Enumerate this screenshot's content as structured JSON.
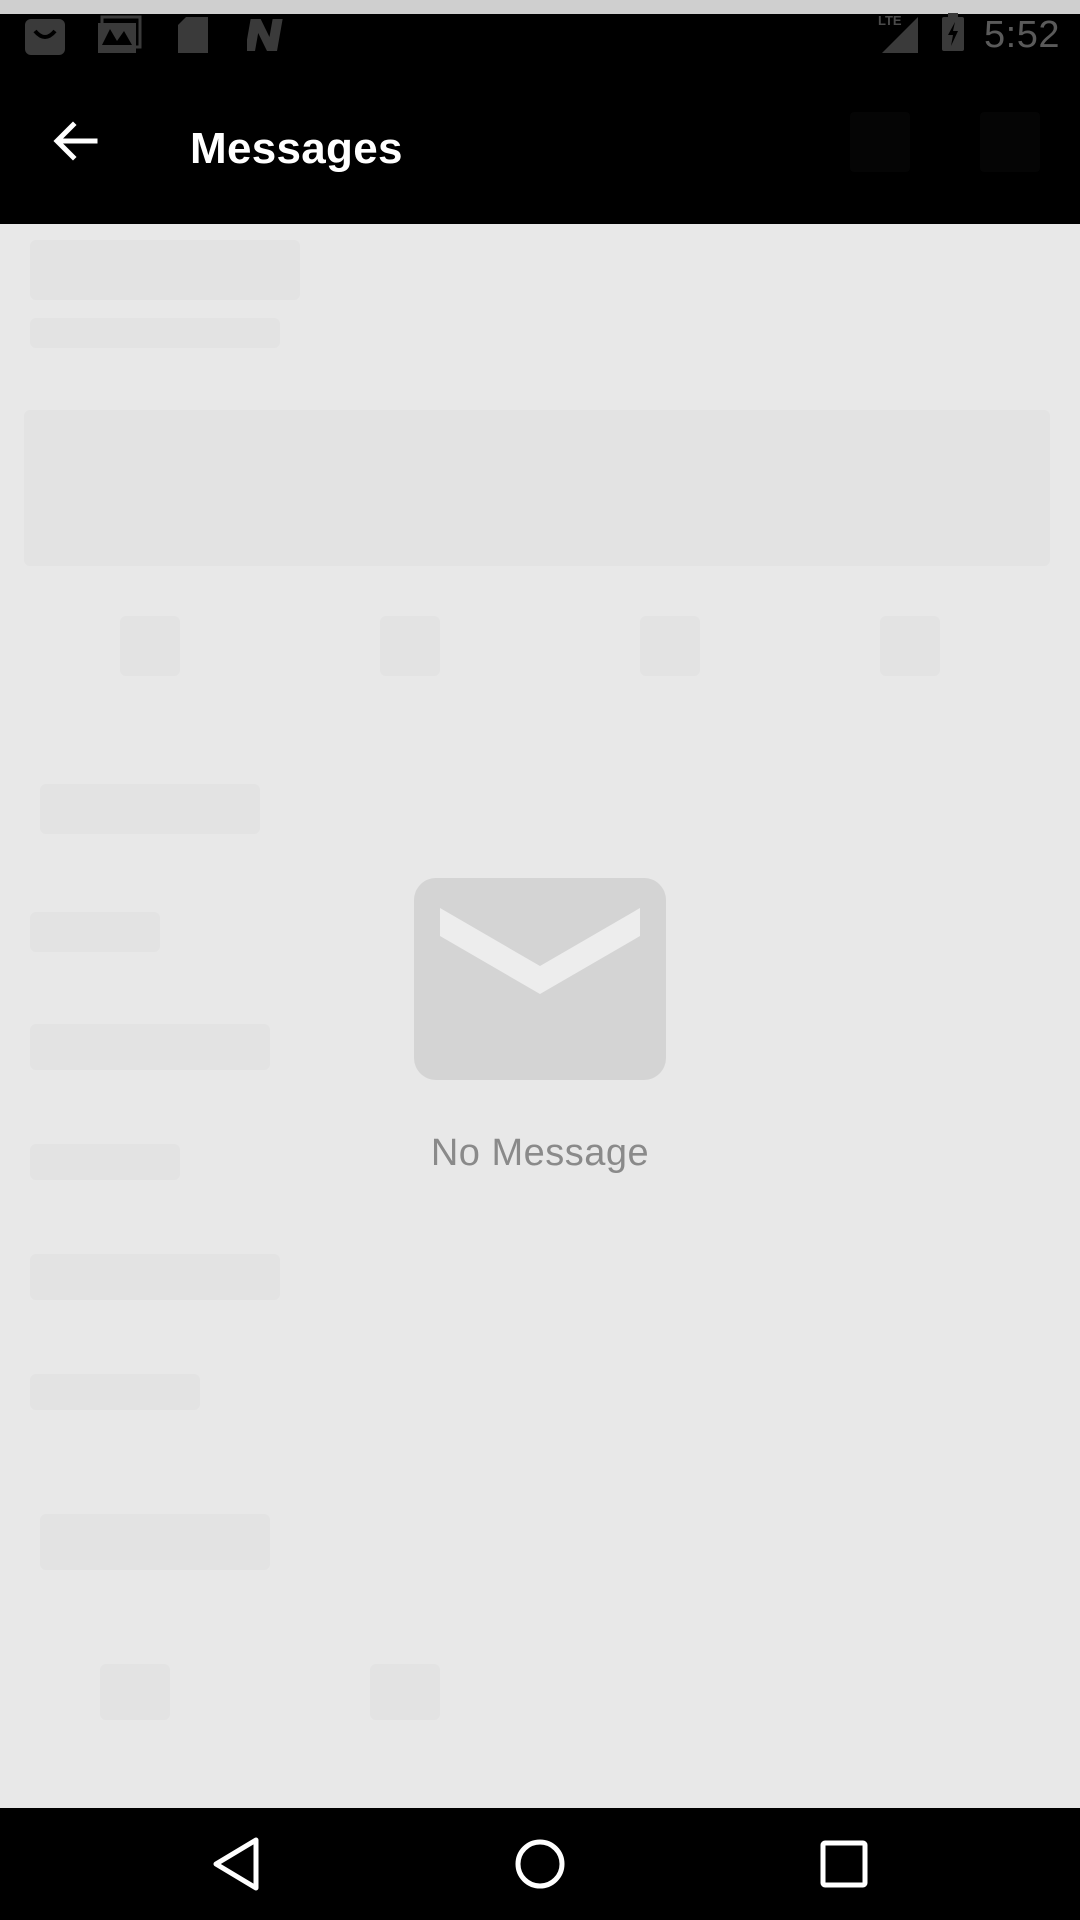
{
  "status_bar": {
    "time": "5:52",
    "icons": [
      "shopping-bag-icon",
      "gallery-icon",
      "sd-card-icon",
      "n-icon",
      "lte-signal-icon",
      "battery-charging-icon"
    ],
    "network": "LTE"
  },
  "app_bar": {
    "title": "Messages",
    "back_icon": "arrow-back-icon"
  },
  "empty_state": {
    "icon": "envelope-icon",
    "text": "No Message"
  },
  "nav_bar": {
    "buttons": [
      "back-triangle-icon",
      "home-circle-icon",
      "recents-square-icon"
    ]
  },
  "colors": {
    "app_bar": "#000000",
    "background": "#e8e8e8",
    "envelope": "#d4d4d4",
    "empty_text": "#8a8a8a"
  }
}
